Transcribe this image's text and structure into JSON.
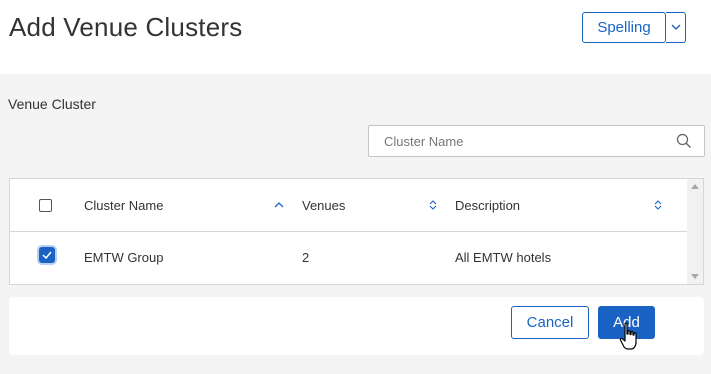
{
  "header": {
    "title": "Add Venue Clusters",
    "spelling_label": "Spelling"
  },
  "section": {
    "label": "Venue Cluster"
  },
  "search": {
    "placeholder": "Cluster Name"
  },
  "table": {
    "columns": [
      "Cluster Name",
      "Venues",
      "Description"
    ],
    "rows": [
      {
        "checked": true,
        "cluster_name": "EMTW Group",
        "venues": "2",
        "description": "All EMTW hotels"
      }
    ]
  },
  "footer": {
    "cancel_label": "Cancel",
    "add_label": "Add"
  },
  "colors": {
    "accent": "#1a63c4",
    "panel_bg": "#f4f4f5"
  }
}
